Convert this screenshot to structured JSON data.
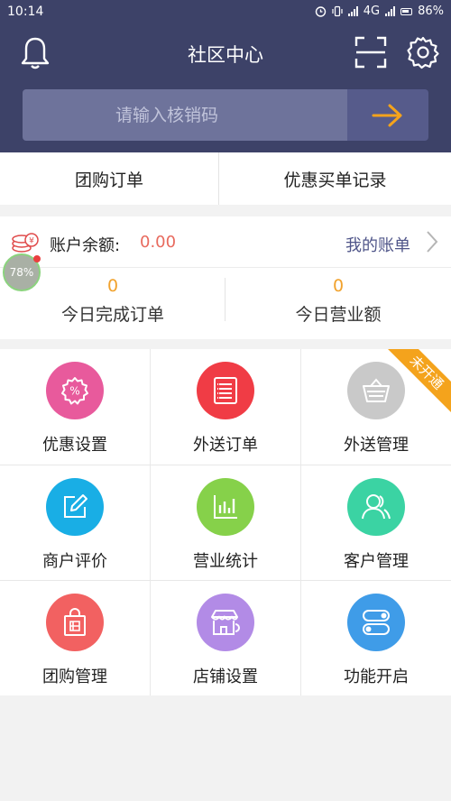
{
  "status_bar": {
    "time": "10:14",
    "network": "4G",
    "battery": "86%"
  },
  "header": {
    "title": "社区中心",
    "search_placeholder": "请输入核销码"
  },
  "tabs": [
    {
      "label": "团购订单"
    },
    {
      "label": "优惠买单记录"
    }
  ],
  "account": {
    "balance_label": "账户余额:",
    "balance_value": "0.00",
    "my_bill_label": "我的账单",
    "stats": [
      {
        "value": "0",
        "label": "今日完成订单"
      },
      {
        "value": "0",
        "label": "今日营业额"
      }
    ]
  },
  "floating_bubble": "78%",
  "grid": [
    {
      "label": "优惠设置",
      "icon": "discount-badge-icon",
      "color": "#e85a9c"
    },
    {
      "label": "外送订单",
      "icon": "order-list-icon",
      "color": "#f03c45"
    },
    {
      "label": "外送管理",
      "icon": "basket-icon",
      "color": "#c9c9c9",
      "badge": "未开通"
    },
    {
      "label": "商户评价",
      "icon": "edit-icon",
      "color": "#19aee5"
    },
    {
      "label": "营业统计",
      "icon": "bar-chart-icon",
      "color": "#86d14a"
    },
    {
      "label": "客户管理",
      "icon": "users-icon",
      "color": "#3bd3a3"
    },
    {
      "label": "团购管理",
      "icon": "shopping-bag-icon",
      "color": "#f26161"
    },
    {
      "label": "店铺设置",
      "icon": "storefront-icon",
      "color": "#b28be6"
    },
    {
      "label": "功能开启",
      "icon": "toggle-switches-icon",
      "color": "#3f9ce8"
    }
  ],
  "colors": {
    "header_bg": "#3d4268",
    "accent_orange": "#f1a22d",
    "amount_red": "#e86a5e",
    "link_blue": "#4f5589"
  }
}
